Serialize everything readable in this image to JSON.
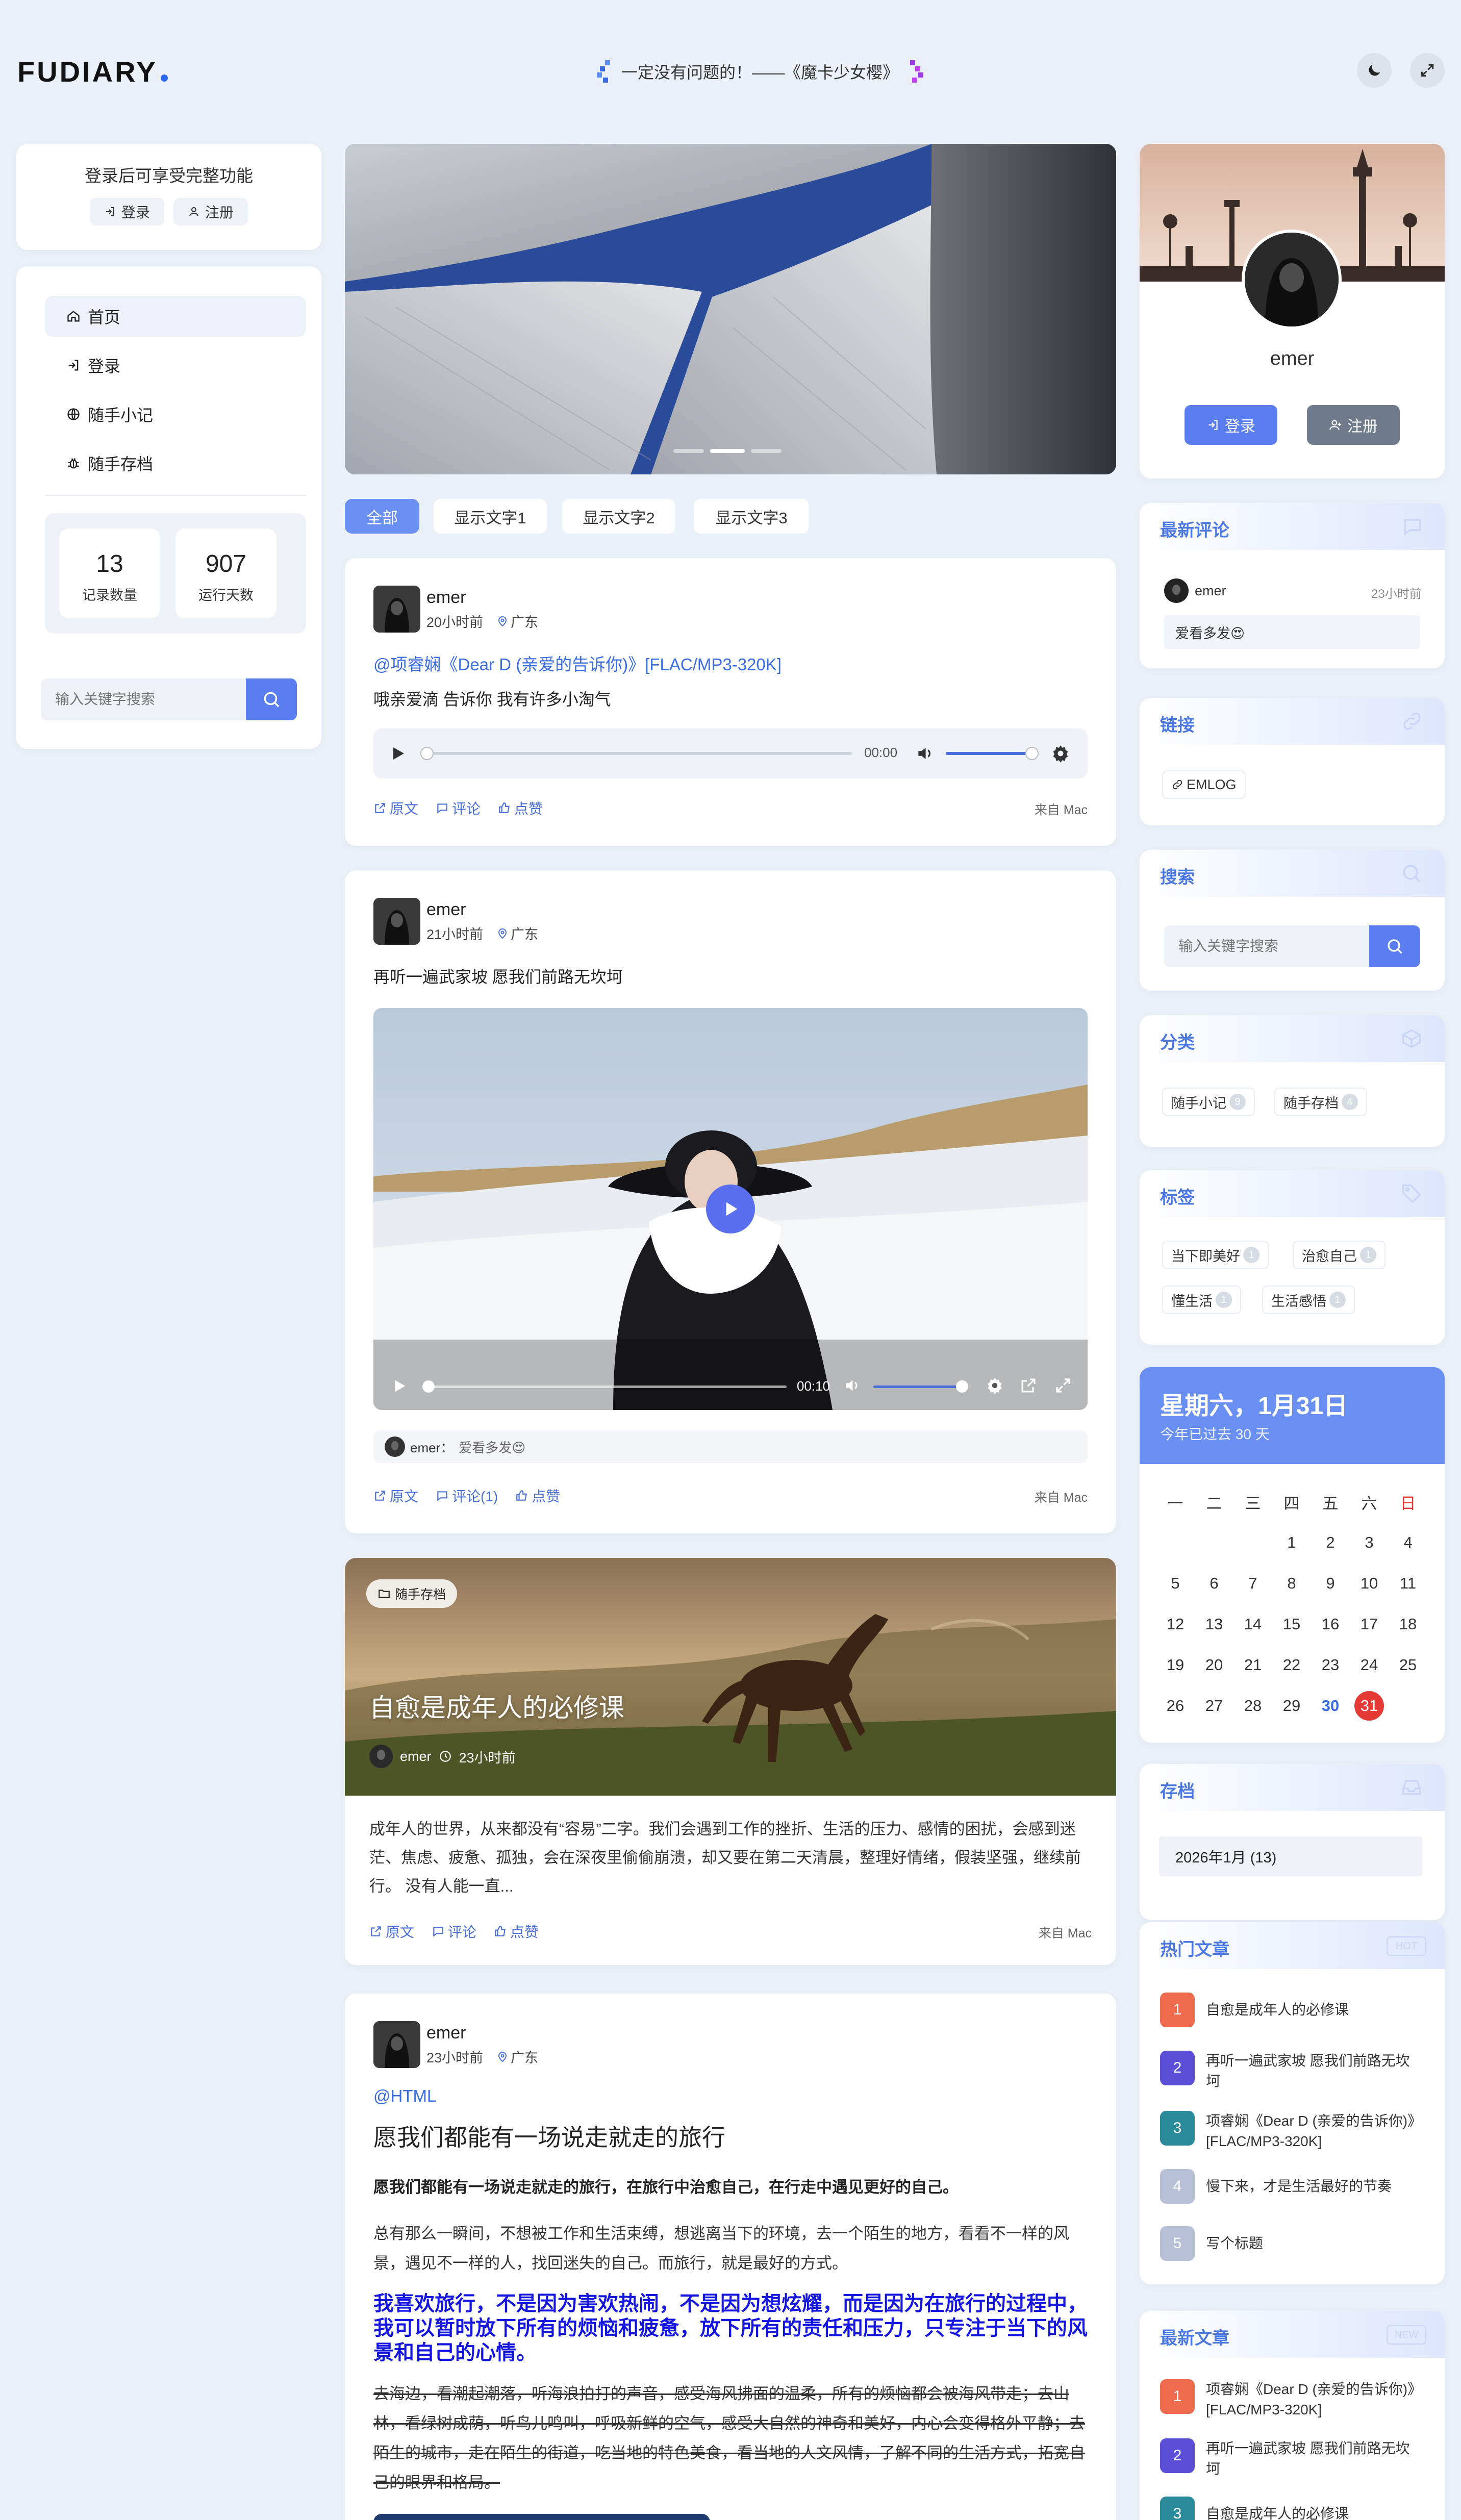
{
  "header": {
    "logo": "FUDIARY",
    "tagline": "一定没有问题的！——《魔卡少女樱》"
  },
  "left": {
    "login_hint": "登录后可享受完整功能",
    "login_btn": "登录",
    "register_btn": "注册",
    "nav": [
      {
        "label": "首页",
        "icon": "home-icon"
      },
      {
        "label": "登录",
        "icon": "login-icon"
      },
      {
        "label": "随手小记",
        "icon": "globe-icon"
      },
      {
        "label": "随手存档",
        "icon": "bug-icon"
      }
    ],
    "stats": [
      {
        "value": "13",
        "label": "记录数量"
      },
      {
        "value": "907",
        "label": "运行天数"
      }
    ],
    "search_placeholder": "输入关键字搜索"
  },
  "filters": [
    "全部",
    "显示文字1",
    "显示文字2",
    "显示文字3"
  ],
  "posts": [
    {
      "author": "emer",
      "time": "20小时前",
      "location": "广东",
      "link": "@项睿娴《Dear D (亲爱的告诉你)》[FLAC/MP3-320K]",
      "text": "哦亲爱滴 告诉你 我有许多小淘气",
      "audio_time": "00:00",
      "actions": [
        "原文",
        "评论",
        "点赞"
      ],
      "from": "来自 Mac"
    },
    {
      "author": "emer",
      "time": "21小时前",
      "location": "广东",
      "text": "再听一遍武家坡 愿我们前路无坎坷",
      "video_time": "00:10",
      "comment_author": "emer：",
      "comment_text": "爱看多发😍",
      "actions": [
        "原文",
        "评论(1)",
        "点赞"
      ],
      "from": "来自 Mac"
    },
    {
      "category": "随手存档",
      "title": "自愈是成年人的必修课",
      "author": "emer",
      "time": "23小时前",
      "excerpt": "成年人的世界，从来都没有“容易”二字。我们会遇到工作的挫折、生活的压力、感情的困扰，会感到迷茫、焦虑、疲惫、孤独，会在深夜里偷偷崩溃，却又要在第二天清晨，整理好情绪，假装坚强，继续前行。 没有人能一直...",
      "actions": [
        "原文",
        "评论",
        "点赞"
      ],
      "from": "来自 Mac"
    },
    {
      "author": "emer",
      "time": "23小时前",
      "location": "广东",
      "link": "@HTML",
      "title": "愿我们都能有一场说走就走的旅行",
      "bold": "愿我们都能有一场说走就走的旅行，在旅行中治愈自己，在行走中遇见更好的自己。",
      "para": "总有那么一瞬间，不想被工作和生活束缚，想逃离当下的环境，去一个陌生的地方，看看不一样的风景，遇见不一样的人，找回迷失的自己。而旅行，就是最好的方式。",
      "blue": "我喜欢旅行，不是因为害欢热闹，不是因为想炫耀，而是因为在旅行的过程中，我可以暂时放下所有的烦恼和疲惫，放下所有的责任和压力，只专注于当下的风景和自己的心情。",
      "strike": "去海边，看潮起潮落，听海浪拍打的声音，感受海风拂面的温柔，所有的烦恼都会被海风带走；去山林，看绿树成荫，听鸟儿鸣叫，呼吸新鲜的空气，感受大自然的神奇和美好，内心会变得格外平静；去陌生的城市，走在陌生的街道，吃当地的特色美食，看当地的人文风情，了解不同的生活方式，拓宽自己的眼界和格局。"
    }
  ],
  "profile": {
    "name": "emer",
    "login_btn": "登录",
    "register_btn": "注册"
  },
  "widgets": {
    "latest_comments": {
      "title": "最新评论",
      "author": "emer",
      "time": "23小时前",
      "text": "爱看多发😍"
    },
    "links": {
      "title": "链接",
      "items": [
        "EMLOG"
      ]
    },
    "search": {
      "title": "搜索",
      "placeholder": "输入关键字搜索"
    },
    "categories": {
      "title": "分类",
      "items": [
        {
          "name": "随手小记",
          "count": "9"
        },
        {
          "name": "随手存档",
          "count": "4"
        }
      ]
    },
    "tags": {
      "title": "标签",
      "items": [
        {
          "name": "当下即美好",
          "count": "1"
        },
        {
          "name": "治愈自己",
          "count": "1"
        },
        {
          "name": "懂生活",
          "count": "1"
        },
        {
          "name": "生活感悟",
          "count": "1"
        }
      ]
    },
    "calendar": {
      "title": "星期六，1月31日",
      "subtitle": "今年已过去 30 天",
      "weekdays": [
        "一",
        "二",
        "三",
        "四",
        "五",
        "六",
        "日"
      ],
      "weeks": [
        [
          "",
          "",
          "",
          "1",
          "2",
          "3",
          "4"
        ],
        [
          "5",
          "6",
          "7",
          "8",
          "9",
          "10",
          "11"
        ],
        [
          "12",
          "13",
          "14",
          "15",
          "16",
          "17",
          "18"
        ],
        [
          "19",
          "20",
          "21",
          "22",
          "23",
          "24",
          "25"
        ],
        [
          "26",
          "27",
          "28",
          "29",
          "30",
          "31",
          ""
        ]
      ],
      "highlight_blue": "30",
      "today": "31",
      "sunday_color": "#e53935",
      "header_color": "#6a8ff3"
    },
    "archive": {
      "title": "存档",
      "items": [
        "2026年1月 (13)"
      ]
    },
    "hot": {
      "title": "热门文章",
      "tag": "HOT",
      "items": [
        {
          "num": "1",
          "title": "自愈是成年人的必修课",
          "color": "#ee6b4d"
        },
        {
          "num": "2",
          "title": "再听一遍武家坡 愿我们前路无坎坷",
          "color": "#5b4fd8"
        },
        {
          "num": "3",
          "title": "项睿娴《Dear D (亲爱的告诉你)》[FLAC/MP3-320K]",
          "color": "#2b8a9a"
        },
        {
          "num": "4",
          "title": "慢下来，才是生活最好的节奏",
          "color": "#b8c0d8"
        },
        {
          "num": "5",
          "title": "写个标题",
          "color": "#b8c0d8"
        }
      ]
    },
    "new": {
      "title": "最新文章",
      "tag": "NEW",
      "items": [
        {
          "num": "1",
          "title": "项睿娴《Dear D (亲爱的告诉你)》[FLAC/MP3-320K]",
          "color": "#ee6b4d"
        },
        {
          "num": "2",
          "title": "再听一遍武家坡 愿我们前路无坎坷",
          "color": "#5b4fd8"
        },
        {
          "num": "3",
          "title": "自愈是成年人的必修课",
          "color": "#2b8a9a"
        }
      ]
    }
  }
}
